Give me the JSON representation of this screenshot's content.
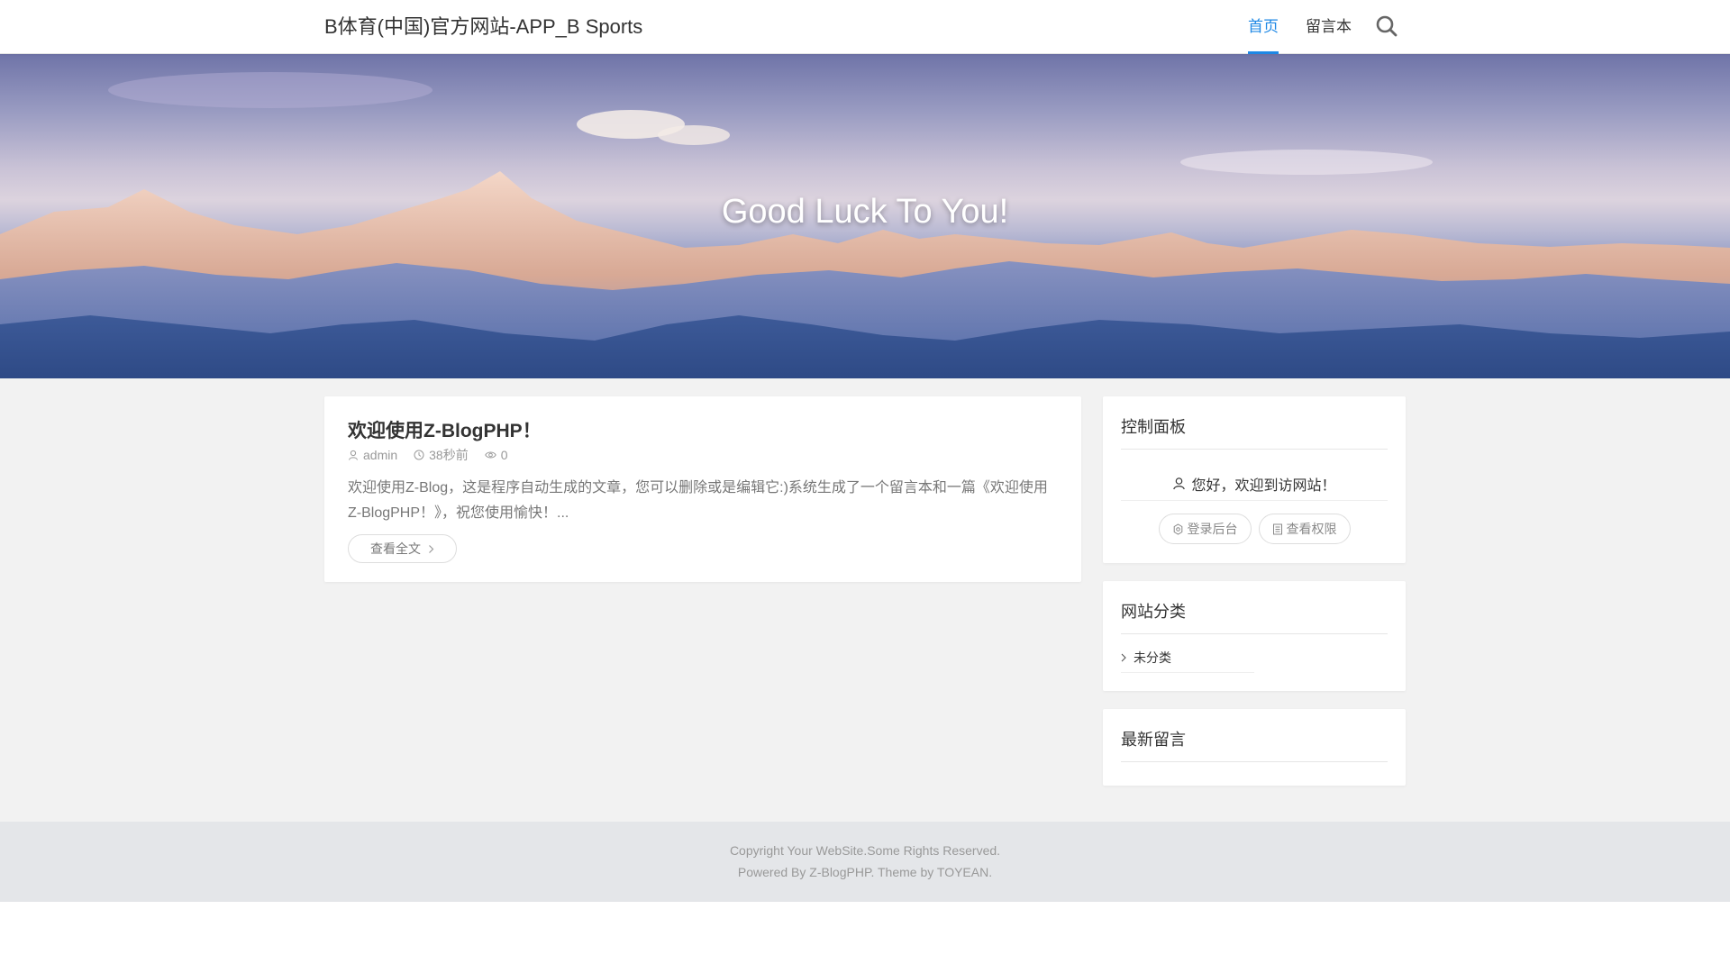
{
  "header": {
    "site_title": "B体育(中国)官方网站-APP_B Sports",
    "nav": [
      {
        "label": "首页",
        "active": true
      },
      {
        "label": "留言本",
        "active": false
      }
    ],
    "search_icon": "search-icon"
  },
  "banner": {
    "text": "Good Luck To You!"
  },
  "post": {
    "title": "欢迎使用Z-BlogPHP！",
    "author": "admin",
    "time": "38秒前",
    "views": "0",
    "excerpt": "欢迎使用Z-Blog，这是程序自动生成的文章，您可以删除或是编辑它:)系统生成了一个留言本和一篇《欢迎使用Z-BlogPHP！》，祝您使用愉快！...",
    "read_more": "查看全文"
  },
  "sidebar": {
    "control_panel": {
      "title": "控制面板",
      "welcome": "您好，欢迎到访网站！",
      "login_button": "登录后台",
      "permission_button": "查看权限"
    },
    "categories": {
      "title": "网站分类",
      "items": [
        "未分类"
      ]
    },
    "latest_comments": {
      "title": "最新留言"
    }
  },
  "footer": {
    "copyright": "Copyright Your WebSite.Some Rights Reserved.",
    "powered": "Powered By Z-BlogPHP. Theme by TOYEAN."
  },
  "colors": {
    "accent": "#1e88e5",
    "background": "#f2f2f2",
    "footer_bg": "#e4e6e9"
  }
}
